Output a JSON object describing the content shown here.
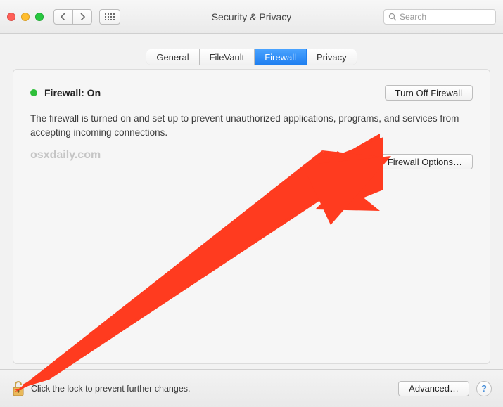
{
  "window": {
    "title": "Security & Privacy"
  },
  "search": {
    "placeholder": "Search"
  },
  "tabs": [
    {
      "label": "General"
    },
    {
      "label": "FileVault"
    },
    {
      "label": "Firewall",
      "active": true
    },
    {
      "label": "Privacy"
    }
  ],
  "firewall": {
    "status_label": "Firewall: On",
    "status_color": "#2fbf3a",
    "toggle_button": "Turn Off Firewall",
    "description": "The firewall is turned on and set up to prevent unauthorized applications, programs, and services from accepting incoming connections.",
    "options_button": "Firewall Options…"
  },
  "watermark": "osxdaily.com",
  "footer": {
    "lock_text": "Click the lock to prevent further changes.",
    "advanced_button": "Advanced…",
    "help_glyph": "?"
  },
  "annotation": {
    "arrow_color": "#ff3b1f"
  }
}
